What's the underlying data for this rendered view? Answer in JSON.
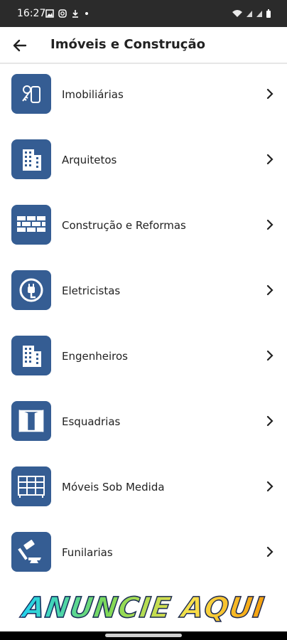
{
  "status_bar": {
    "time": "16:27",
    "left_icons": [
      "image-icon",
      "instagram-icon",
      "download-icon",
      "dot-icon"
    ],
    "right_icons": [
      "wifi-icon",
      "signal-icon",
      "signal-icon",
      "battery-icon"
    ]
  },
  "app_bar": {
    "title": "Imóveis e Construção",
    "back_icon": "arrow-left-icon"
  },
  "categories": [
    {
      "label": "Imobiliárias",
      "icon": "keys-icon"
    },
    {
      "label": "Arquitetos",
      "icon": "building-icon"
    },
    {
      "label": "Construção e Reformas",
      "icon": "brick-wall-icon"
    },
    {
      "label": "Eletricistas",
      "icon": "plug-icon"
    },
    {
      "label": "Engenheiros",
      "icon": "building-icon"
    },
    {
      "label": "Esquadrias",
      "icon": "window-icon"
    },
    {
      "label": "Móveis Sob Medida",
      "icon": "cabinet-icon"
    },
    {
      "label": "Funilarias",
      "icon": "hammer-anvil-icon"
    }
  ],
  "banner": {
    "text": "ANUNCIE AQUI"
  },
  "colors": {
    "icon_bg": "#355d93",
    "status_bar": "#2b2b2b",
    "text": "#222222"
  }
}
